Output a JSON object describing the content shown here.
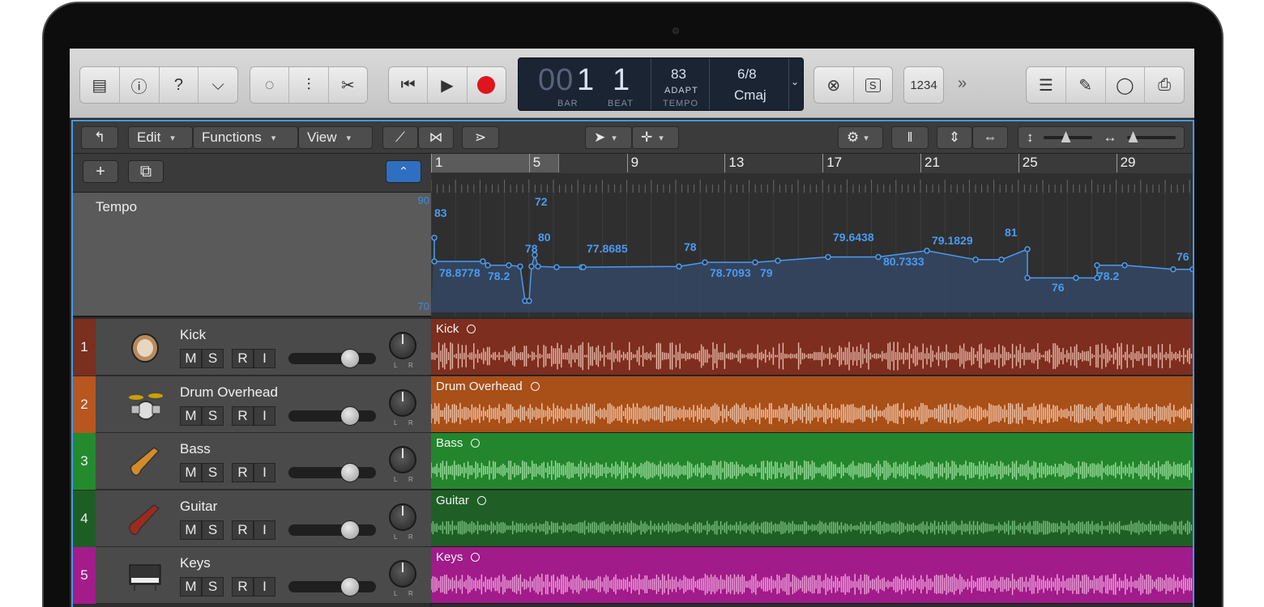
{
  "transport": {
    "bar_dim": "00",
    "bar": "1",
    "beat": "1",
    "bar_label": "BAR",
    "beat_label": "BEAT",
    "tempo": "83",
    "tempo_mode": "ADAPT",
    "tempo_label": "TEMPO",
    "signature": "6/8",
    "key": "Cmaj",
    "count_in": "1234"
  },
  "local_menu": {
    "edit": "Edit",
    "functions": "Functions",
    "view": "View"
  },
  "tempo_track": {
    "title": "Tempo",
    "range_max": "90",
    "range_min": "70",
    "labels": [
      {
        "text": "83",
        "value": 83
      },
      {
        "text": "72",
        "value": 72
      },
      {
        "text": "80",
        "value": 80
      },
      {
        "text": "78.8778",
        "value": 78.8778
      },
      {
        "text": "78.2",
        "value": 78.2
      },
      {
        "text": "78",
        "value": 78
      },
      {
        "text": "77.8685",
        "value": 77.8685
      },
      {
        "text": "78",
        "value": 78
      },
      {
        "text": "78.7093",
        "value": 78.7093
      },
      {
        "text": "79",
        "value": 79
      },
      {
        "text": "79.6438",
        "value": 79.6438
      },
      {
        "text": "80.7333",
        "value": 80.7333
      },
      {
        "text": "79.1829",
        "value": 79.1829
      },
      {
        "text": "81",
        "value": 81
      },
      {
        "text": "76",
        "value": 76
      },
      {
        "text": "78.2",
        "value": 78.2
      },
      {
        "text": "76",
        "value": 76
      }
    ]
  },
  "ruler": {
    "bars": [
      "1",
      "5",
      "9",
      "13",
      "17",
      "21",
      "25",
      "29"
    ]
  },
  "tracks": [
    {
      "number": "1",
      "name": "Kick",
      "color": "#7a2f1f",
      "region_color": "#7d2e1e",
      "wave_color": "#e8b8a8",
      "icon": "kick-drum-icon",
      "fader": 0.7
    },
    {
      "number": "2",
      "name": "Drum Overhead",
      "color": "#b8561f",
      "region_color": "#a94f18",
      "wave_color": "#f4c9ad",
      "icon": "drum-kit-icon",
      "fader": 0.7
    },
    {
      "number": "3",
      "name": "Bass",
      "color": "#248a2e",
      "region_color": "#23862d",
      "wave_color": "#9ee0a0",
      "icon": "bass-guitar-icon",
      "fader": 0.7
    },
    {
      "number": "4",
      "name": "Guitar",
      "color": "#1d5e24",
      "region_color": "#1f5f26",
      "wave_color": "#78c27e",
      "icon": "electric-guitar-icon",
      "fader": 0.7
    },
    {
      "number": "5",
      "name": "Keys",
      "color": "#a41c8c",
      "region_color": "#a11b8a",
      "wave_color": "#f0a6dc",
      "icon": "keyboard-icon",
      "fader": 0.7
    }
  ],
  "track_buttons": {
    "mute": "M",
    "solo": "S",
    "record": "R",
    "input": "I"
  },
  "pan_labels": {
    "left": "L",
    "right": "R"
  }
}
